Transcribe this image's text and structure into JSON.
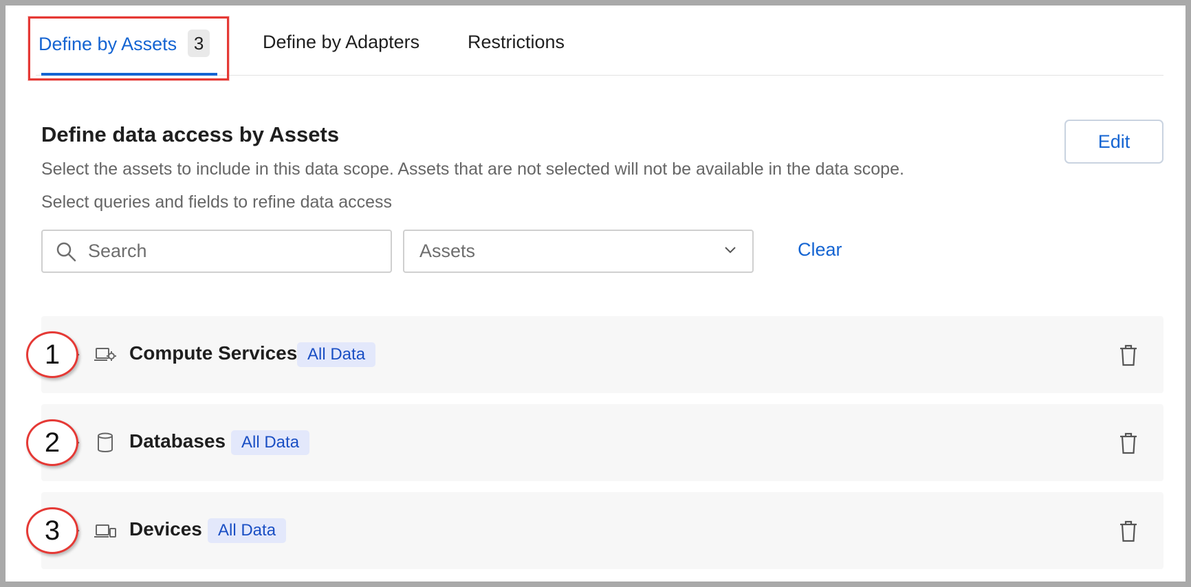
{
  "tabs": [
    {
      "label": "Define by Assets",
      "count": "3",
      "active": true
    },
    {
      "label": "Define by Adapters",
      "active": false
    },
    {
      "label": "Restrictions",
      "active": false
    }
  ],
  "section": {
    "title": "Define data access by Assets",
    "description": "Select the assets to include in this data scope. Assets that are not selected will not be available in the data scope.",
    "description2": "Select queries and fields to refine data access",
    "edit_label": "Edit"
  },
  "filters": {
    "search_placeholder": "Search",
    "select_value": "Assets",
    "clear_label": "Clear"
  },
  "assets": [
    {
      "callout": "1",
      "name": "Compute Services",
      "badge": "All Data",
      "icon": "compute-services-icon"
    },
    {
      "callout": "2",
      "name": "Databases",
      "badge": "All Data",
      "icon": "database-icon"
    },
    {
      "callout": "3",
      "name": "Devices",
      "badge": "All Data",
      "icon": "devices-icon"
    }
  ],
  "colors": {
    "accent": "#1464d2",
    "badge_bg": "#e3e8fb",
    "highlight": "#e53935"
  }
}
